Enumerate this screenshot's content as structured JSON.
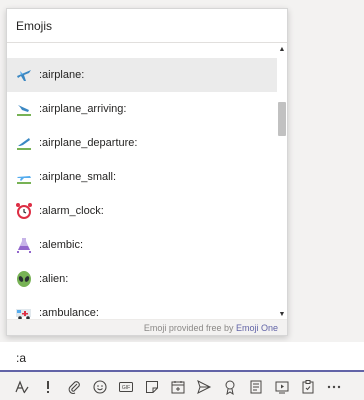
{
  "popup": {
    "title": "Emojis",
    "footer_prefix": "Emoji provided free by ",
    "footer_link": "Emoji One",
    "scroll_up": "▲",
    "scroll_down": "▼"
  },
  "emojis": [
    {
      "icon": "airplane-icon",
      "label": ":airplane:",
      "selected": true
    },
    {
      "icon": "airplane-arriving-icon",
      "label": ":airplane_arriving:"
    },
    {
      "icon": "airplane-departure-icon",
      "label": ":airplane_departure:"
    },
    {
      "icon": "airplane-small-icon",
      "label": ":airplane_small:"
    },
    {
      "icon": "alarm-clock-icon",
      "label": ":alarm_clock:"
    },
    {
      "icon": "alembic-icon",
      "label": ":alembic:"
    },
    {
      "icon": "alien-icon",
      "label": ":alien:"
    },
    {
      "icon": "ambulance-icon",
      "label": ":ambulance:"
    }
  ],
  "compose": {
    "value": ":a"
  },
  "toolbar": {
    "buttons": [
      "format-icon",
      "important-icon",
      "attach-icon",
      "emoji-icon",
      "gif-icon",
      "sticker-icon",
      "meeting-icon",
      "send-icon",
      "praise-icon",
      "notes-icon",
      "stream-icon",
      "clipboard-icon",
      "more-icon"
    ]
  },
  "colors": {
    "accent": "#6264a7",
    "selected_row": "#ebebeb",
    "background": "#f3f2f1"
  }
}
